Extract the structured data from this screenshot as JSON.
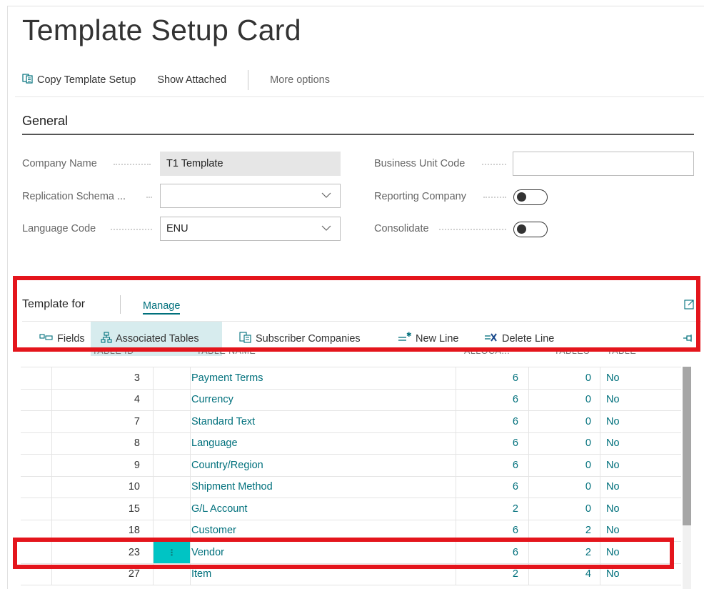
{
  "page": {
    "title": "Template Setup Card"
  },
  "actions": {
    "copy_template_setup": "Copy Template Setup",
    "show_attached": "Show Attached",
    "more_options": "More options"
  },
  "general": {
    "section_title": "General",
    "company_name_label": "Company Name",
    "company_name_value": "T1 Template",
    "replication_schema_label": "Replication Schema ...",
    "replication_schema_value": "",
    "language_code_label": "Language Code",
    "language_code_value": "ENU",
    "business_unit_code_label": "Business Unit Code",
    "business_unit_code_value": "",
    "reporting_company_label": "Reporting Company",
    "reporting_company_on": false,
    "consolidate_label": "Consolidate",
    "consolidate_on": false
  },
  "subpage": {
    "title": "Template for",
    "manage_tab": "Manage",
    "actions": {
      "fields": "Fields",
      "associated_tables": "Associated Tables",
      "subscriber_companies": "Subscriber Companies",
      "new_line": "New Line",
      "delete_line": "Delete Line"
    },
    "columns": {
      "table_id": "TABLE ID",
      "table_name": "TABLE NAME",
      "allocations": "ALLOCA...",
      "tables": "TABLES",
      "table": "TABLE"
    },
    "selected_row_marker": "⋮",
    "rows": [
      {
        "id": "3",
        "name": "Payment Terms",
        "alloc": "6",
        "tables": "0",
        "flag": "No"
      },
      {
        "id": "4",
        "name": "Currency",
        "alloc": "6",
        "tables": "0",
        "flag": "No"
      },
      {
        "id": "7",
        "name": "Standard Text",
        "alloc": "6",
        "tables": "0",
        "flag": "No"
      },
      {
        "id": "8",
        "name": "Language",
        "alloc": "6",
        "tables": "0",
        "flag": "No"
      },
      {
        "id": "9",
        "name": "Country/Region",
        "alloc": "6",
        "tables": "0",
        "flag": "No"
      },
      {
        "id": "10",
        "name": "Shipment Method",
        "alloc": "6",
        "tables": "0",
        "flag": "No"
      },
      {
        "id": "15",
        "name": "G/L Account",
        "alloc": "2",
        "tables": "0",
        "flag": "No"
      },
      {
        "id": "18",
        "name": "Customer",
        "alloc": "6",
        "tables": "2",
        "flag": "No"
      },
      {
        "id": "23",
        "name": "Vendor",
        "alloc": "6",
        "tables": "2",
        "flag": "No"
      },
      {
        "id": "27",
        "name": "Item",
        "alloc": "2",
        "tables": "4",
        "flag": "No"
      }
    ]
  },
  "colors": {
    "accent": "#00707c",
    "highlight_box": "#e4151c",
    "selected_cell": "#00c4c4",
    "active_action": "#d7ecee"
  }
}
